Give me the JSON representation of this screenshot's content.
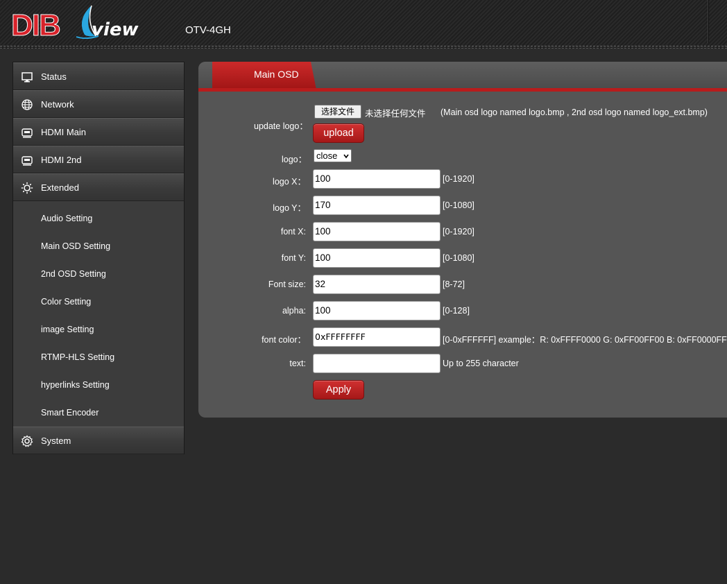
{
  "header": {
    "brand_left": "DIB",
    "brand_right": "view",
    "model": "OTV-4GH"
  },
  "sidebar": {
    "items": [
      {
        "label": "Status",
        "icon": "monitor-icon"
      },
      {
        "label": "Network",
        "icon": "globe-icon"
      },
      {
        "label": "HDMI Main",
        "icon": "hdmi-icon"
      },
      {
        "label": "HDMI 2nd",
        "icon": "hdmi-icon"
      },
      {
        "label": "Extended",
        "icon": "sun-gear-icon"
      }
    ],
    "sub_items": [
      "Audio Setting",
      "Main OSD Setting",
      "2nd OSD Setting",
      "Color Setting",
      "image Setting",
      "RTMP-HLS Setting",
      "hyperlinks Setting",
      "Smart Encoder"
    ],
    "system": {
      "label": "System",
      "icon": "gear-icon"
    }
  },
  "panel": {
    "tab": "Main OSD",
    "update_logo": {
      "label": "update logo：",
      "file_button": "选择文件",
      "file_status": "未选择任何文件",
      "note": "(Main osd logo named logo.bmp , 2nd osd logo named logo_ext.bmp)",
      "upload_button": "upload"
    },
    "logo": {
      "label": "logo：",
      "selected": "close"
    },
    "fields": [
      {
        "label": "logo X：",
        "value": "100",
        "hint": "[0-1920]"
      },
      {
        "label": "logo Y：",
        "value": "170",
        "hint": "[0-1080]"
      },
      {
        "label": "font X:",
        "value": "100",
        "hint": "[0-1920]"
      },
      {
        "label": "font Y:",
        "value": "100",
        "hint": "[0-1080]"
      },
      {
        "label": "Font size:",
        "value": "32",
        "hint": "[8-72]"
      },
      {
        "label": "alpha:",
        "value": "100",
        "hint": "[0-128]"
      },
      {
        "label": "font color：",
        "value": "0xFFFFFFFF",
        "hint": "[0-0xFFFFFF] example：R: 0xFFFF0000 G: 0xFF00FF00 B: 0xFF0000FF"
      },
      {
        "label": "text:",
        "value": "",
        "hint": "Up to 255 character"
      }
    ],
    "apply_button": "Apply"
  },
  "colors": {
    "accent_red": "#b81c1c",
    "panel_bg": "#555555",
    "page_bg": "#2b2b2b"
  }
}
